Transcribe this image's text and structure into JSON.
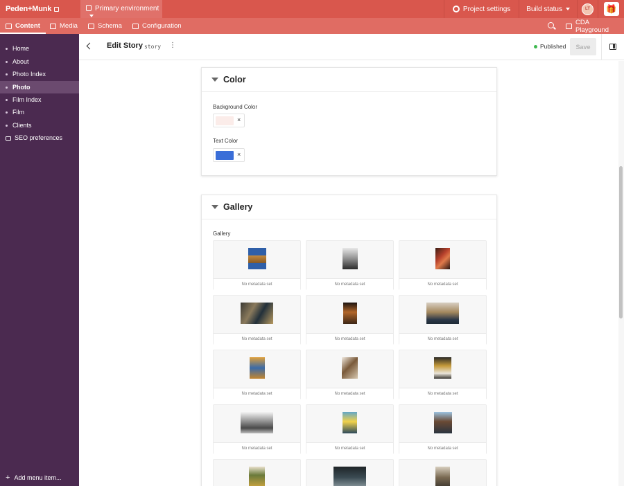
{
  "topbar": {
    "brand": "Peden+Munk",
    "environment": "Primary environment",
    "project_settings": "Project settings",
    "build_status": "Build status",
    "avatar_initials": "LT"
  },
  "subnav": {
    "tabs": [
      {
        "label": "Content",
        "icon": "pencil-icon",
        "active": true
      },
      {
        "label": "Media",
        "icon": "image-icon",
        "active": false
      },
      {
        "label": "Schema",
        "icon": "schema-icon",
        "active": false
      },
      {
        "label": "Configuration",
        "icon": "people-icon",
        "active": false
      }
    ],
    "cda_playground": "CDA Playground"
  },
  "sidebar": {
    "items": [
      {
        "label": "Home",
        "active": false
      },
      {
        "label": "About",
        "active": false
      },
      {
        "label": "Photo Index",
        "active": false
      },
      {
        "label": "Photo",
        "active": true
      },
      {
        "label": "Film Index",
        "active": false
      },
      {
        "label": "Film",
        "active": false
      },
      {
        "label": "Clients",
        "active": false
      },
      {
        "label": "SEO preferences",
        "active": false
      }
    ],
    "add_menu_item": "Add menu item..."
  },
  "editor": {
    "title": "Edit Story",
    "model": "story",
    "status": "Published",
    "save_label": "Save"
  },
  "color_section": {
    "title": "Color",
    "fields": [
      {
        "label": "Background Color",
        "value": "#fbece9"
      },
      {
        "label": "Text Color",
        "value": "#3a6ed8"
      }
    ],
    "clear_glyph": "×"
  },
  "gallery_section": {
    "title": "Gallery",
    "field_label": "Gallery",
    "meta_label": "No metadata set",
    "items_count_visible": 15
  },
  "colors": {
    "topbar": "#d9574d",
    "subnav": "#e06c63",
    "sidebar": "#4b2a50",
    "published_dot": "#3fb950"
  }
}
